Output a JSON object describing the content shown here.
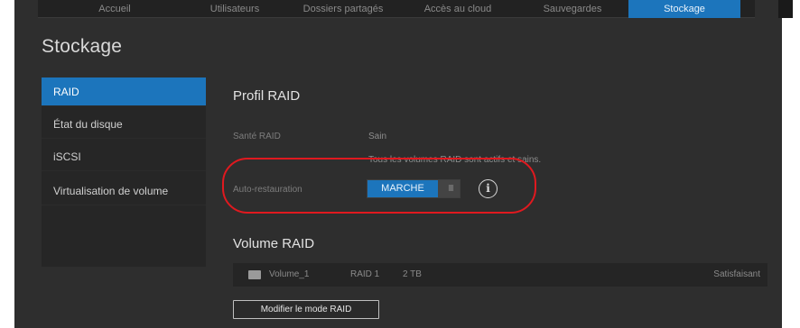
{
  "nav": {
    "tabs": [
      {
        "label": "Accueil",
        "active": false
      },
      {
        "label": "Utilisateurs",
        "active": false
      },
      {
        "label": "Dossiers partagés",
        "active": false
      },
      {
        "label": "Accès au cloud",
        "active": false
      },
      {
        "label": "Sauvegardes",
        "active": false
      },
      {
        "label": "Stockage",
        "active": true
      }
    ]
  },
  "page": {
    "title": "Stockage"
  },
  "sidebar": {
    "items": [
      {
        "label": "RAID",
        "active": true
      },
      {
        "label": "État du disque",
        "active": false
      },
      {
        "label": "iSCSI",
        "active": false
      },
      {
        "label": "Virtualisation de volume",
        "active": false
      }
    ]
  },
  "raid_profile": {
    "title": "Profil RAID",
    "health_label": "Santé RAID",
    "health_value": "Sain",
    "health_detail": "Tous les volumes RAID sont actifs et sains.",
    "auto_restore_label": "Auto-restauration",
    "auto_restore_toggle": "MARCHE",
    "toggle_grip": "III",
    "info_glyph": "i"
  },
  "volume": {
    "title": "Volume RAID",
    "rows": [
      {
        "name": "Volume_1",
        "raid": "RAID 1",
        "size": "2 TB",
        "status": "Satisfaisant"
      }
    ],
    "modify_button": "Modifier le mode RAID"
  },
  "colors": {
    "accent": "#1c75bc",
    "highlight": "#e0191f",
    "background": "#2e2e2e"
  }
}
